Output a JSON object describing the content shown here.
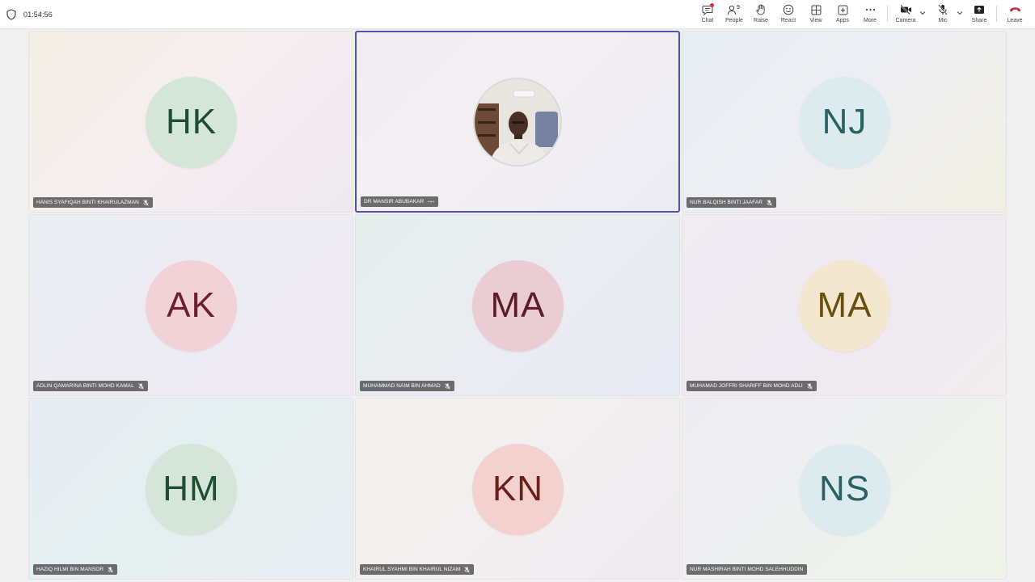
{
  "meeting": {
    "timer": "01:54:56"
  },
  "toolbar": {
    "chat_label": "Chat",
    "people_label": "People",
    "people_count": "9",
    "raise_label": "Raise",
    "react_label": "React",
    "view_label": "View",
    "apps_label": "Apps",
    "more_label": "More",
    "camera_label": "Camera",
    "mic_label": "Mic",
    "share_label": "Share",
    "leave_label": "Leave"
  },
  "participants": [
    {
      "initials": "HK",
      "name": "HANIS SYAFIQAH BINTI KHAIRULAZMAN",
      "avatar_bg": "#d4e6d8",
      "avatar_fg": "#1e4d31",
      "muted": true
    },
    {
      "initials": "",
      "name": "DR MANSIR ABUBAKAR",
      "avatar_bg": "#cfcfcf",
      "avatar_fg": "#333333",
      "muted": false,
      "video": true,
      "active_speaker": true
    },
    {
      "initials": "NJ",
      "name": "NUR BALQISH BINTI JAAFAR",
      "avatar_bg": "#dcecee",
      "avatar_fg": "#2a6162",
      "muted": true
    },
    {
      "initials": "AK",
      "name": "ADLIN QAMARINA BINTI MOHD KAMAL",
      "avatar_bg": "#f1d3d7",
      "avatar_fg": "#6e1e2c",
      "muted": true
    },
    {
      "initials": "MA",
      "name": "MUHAMMAD NAIM BIN AHMAD",
      "avatar_bg": "#eacdd3",
      "avatar_fg": "#5f1a27",
      "muted": true
    },
    {
      "initials": "MA",
      "name": "MUHAMAD JOFFRI SHARIFF BIN MOHD ADLI",
      "avatar_bg": "#f3e8cf",
      "avatar_fg": "#6b4d10",
      "muted": true
    },
    {
      "initials": "HM",
      "name": "HAZIQ HILMI BIN MANSOR",
      "avatar_bg": "#d5e5d9",
      "avatar_fg": "#1e4d31",
      "muted": true
    },
    {
      "initials": "KN",
      "name": "KHAIRUL SYAHMI BIN KHAIRUL NIZAM",
      "avatar_bg": "#f2d1cf",
      "avatar_fg": "#6a1f1a",
      "muted": true
    },
    {
      "initials": "NS",
      "name": "NUR MASHIRAH BINTI MOHD SALEHHUDDIN",
      "avatar_bg": "#dcecee",
      "avatar_fg": "#2a6162",
      "muted": false
    }
  ],
  "colors": {
    "accent": "#4f52b2",
    "leave": "#c4314b",
    "notification": "#d13438"
  }
}
